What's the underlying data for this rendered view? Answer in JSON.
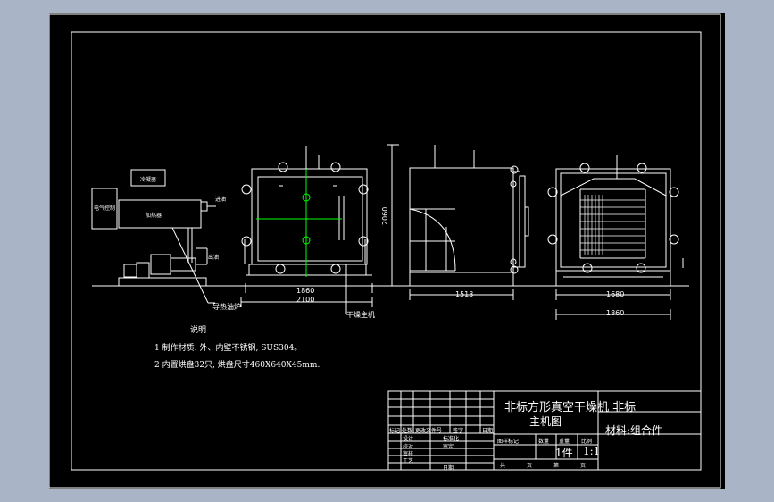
{
  "title_block": {
    "title_line1": "非标方形真空干燥机   非标",
    "title_line2": "主机图",
    "material": "材料:组合件",
    "quantity": "1件",
    "scale": "1:1",
    "header_labels": [
      "图样标记",
      "数量",
      "重量",
      "比例"
    ],
    "revision_labels": [
      "标记",
      "处数",
      "更改文件号",
      "签字",
      "日期"
    ],
    "role_labels": [
      "设计",
      "校对",
      "审核",
      "工艺"
    ],
    "role_values": [
      "标准化",
      "审定",
      "",
      "日期"
    ],
    "sheet_labels": [
      "共",
      "页",
      "第",
      "页"
    ]
  },
  "notes": {
    "heading": "说明",
    "item1": "1 制作材质: 外、内壁不锈钢, SUS304。",
    "item2": "2 内置烘盘32只, 烘盘尺寸460X640X45mm."
  },
  "front_view": {
    "dim_inner": "1860",
    "dim_outer": "2100",
    "label_dryer": "干燥主机"
  },
  "side_view": {
    "dim_height": "2060",
    "dim_width": "1513"
  },
  "rear_view": {
    "dim_inner": "1680",
    "dim_outer": "1860"
  },
  "pump_unit": {
    "label_condenser": "冷凝器",
    "label_cabinet": "电气控制",
    "label_heater": "加热器",
    "label_inlet": "进油",
    "label_outlet": "出油",
    "label_pump": "导热油炉"
  },
  "colors": {
    "background": "#a9b4c7",
    "drawing_bg": "#000000",
    "line": "#ffffff",
    "center_line": "#00ff00"
  }
}
